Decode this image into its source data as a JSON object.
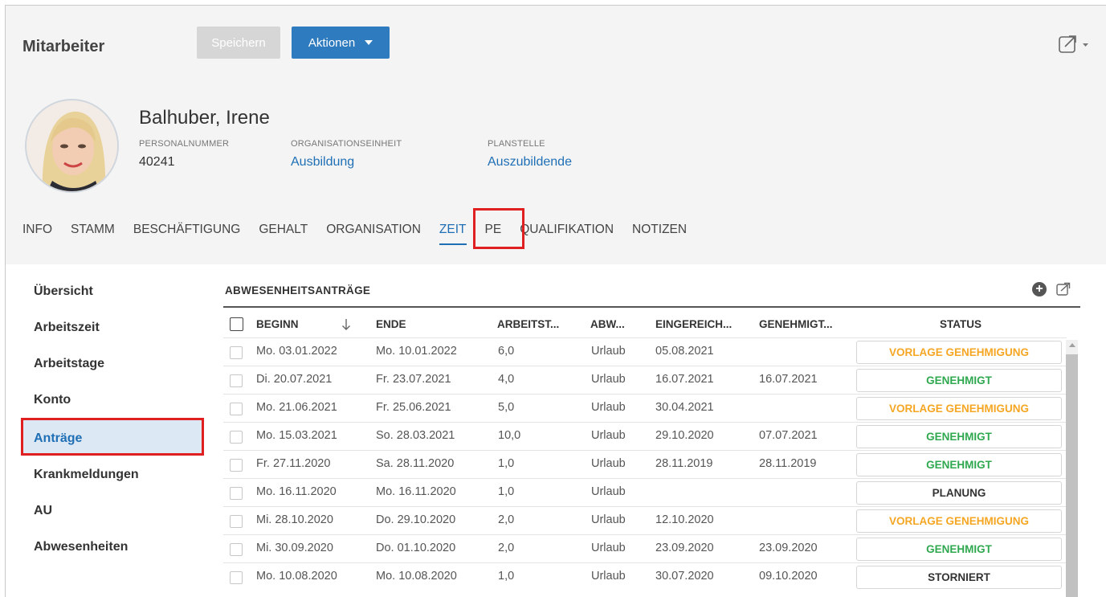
{
  "header": {
    "title": "Mitarbeiter",
    "save_label": "Speichern",
    "actions_label": "Aktionen",
    "share_icon": "share-icon"
  },
  "employee": {
    "name": "Balhuber, Irene",
    "personalnummer_label": "PERSONALNUMMER",
    "personalnummer": "40241",
    "org_label": "ORGANISATIONSEINHEIT",
    "org": "Ausbildung",
    "plan_label": "PLANSTELLE",
    "plan": "Auszubildende"
  },
  "tabs": [
    "INFO",
    "STAMM",
    "BESCHÄFTIGUNG",
    "GEHALT",
    "ORGANISATION",
    "ZEIT",
    "PE",
    "QUALIFIKATION",
    "NOTIZEN"
  ],
  "active_tab": "ZEIT",
  "sidebar": {
    "items": [
      "Übersicht",
      "Arbeitszeit",
      "Arbeitstage",
      "Konto",
      "Anträge",
      "Krankmeldungen",
      "AU",
      "Abwesenheiten"
    ],
    "active": "Anträge"
  },
  "section": {
    "title": "ABWESENHEITSANTRÄGE",
    "add_icon": "plus-circle-icon",
    "export_icon": "share-icon"
  },
  "table": {
    "columns": [
      "BEGINN",
      "ENDE",
      "ARBEITST...",
      "ABW...",
      "EINGEREICH...",
      "GENEHMIGT...",
      "STATUS"
    ],
    "sort_icon": "arrow-down-icon",
    "rows": [
      {
        "beginn": "Mo. 03.01.2022",
        "ende": "Mo. 10.01.2022",
        "tage": "6,0",
        "abw": "Urlaub",
        "eingereicht": "05.08.2021",
        "genehmigt": "",
        "status": "VORLAGE GENEHMIGUNG",
        "color": "#f5a623"
      },
      {
        "beginn": "Di. 20.07.2021",
        "ende": "Fr. 23.07.2021",
        "tage": "4,0",
        "abw": "Urlaub",
        "eingereicht": "16.07.2021",
        "genehmigt": "16.07.2021",
        "status": "GENEHMIGT",
        "color": "#2fa84f"
      },
      {
        "beginn": "Mo. 21.06.2021",
        "ende": "Fr. 25.06.2021",
        "tage": "5,0",
        "abw": "Urlaub",
        "eingereicht": "30.04.2021",
        "genehmigt": "",
        "status": "VORLAGE GENEHMIGUNG",
        "color": "#f5a623"
      },
      {
        "beginn": "Mo. 15.03.2021",
        "ende": "So. 28.03.2021",
        "tage": "10,0",
        "abw": "Urlaub",
        "eingereicht": "29.10.2020",
        "genehmigt": "07.07.2021",
        "status": "GENEHMIGT",
        "color": "#2fa84f"
      },
      {
        "beginn": "Fr. 27.11.2020",
        "ende": "Sa. 28.11.2020",
        "tage": "1,0",
        "abw": "Urlaub",
        "eingereicht": "28.11.2019",
        "genehmigt": "28.11.2019",
        "status": "GENEHMIGT",
        "color": "#2fa84f"
      },
      {
        "beginn": "Mo. 16.11.2020",
        "ende": "Mo. 16.11.2020",
        "tage": "1,0",
        "abw": "Urlaub",
        "eingereicht": "",
        "genehmigt": "",
        "status": "PLANUNG",
        "color": "#333333"
      },
      {
        "beginn": "Mi. 28.10.2020",
        "ende": "Do. 29.10.2020",
        "tage": "2,0",
        "abw": "Urlaub",
        "eingereicht": "12.10.2020",
        "genehmigt": "",
        "status": "VORLAGE GENEHMIGUNG",
        "color": "#f5a623"
      },
      {
        "beginn": "Mi. 30.09.2020",
        "ende": "Do. 01.10.2020",
        "tage": "2,0",
        "abw": "Urlaub",
        "eingereicht": "23.09.2020",
        "genehmigt": "23.09.2020",
        "status": "GENEHMIGT",
        "color": "#2fa84f"
      },
      {
        "beginn": "Mo. 10.08.2020",
        "ende": "Mo. 10.08.2020",
        "tage": "1,0",
        "abw": "Urlaub",
        "eingereicht": "30.07.2020",
        "genehmigt": "09.10.2020",
        "status": "STORNIERT",
        "color": "#333333"
      }
    ]
  }
}
